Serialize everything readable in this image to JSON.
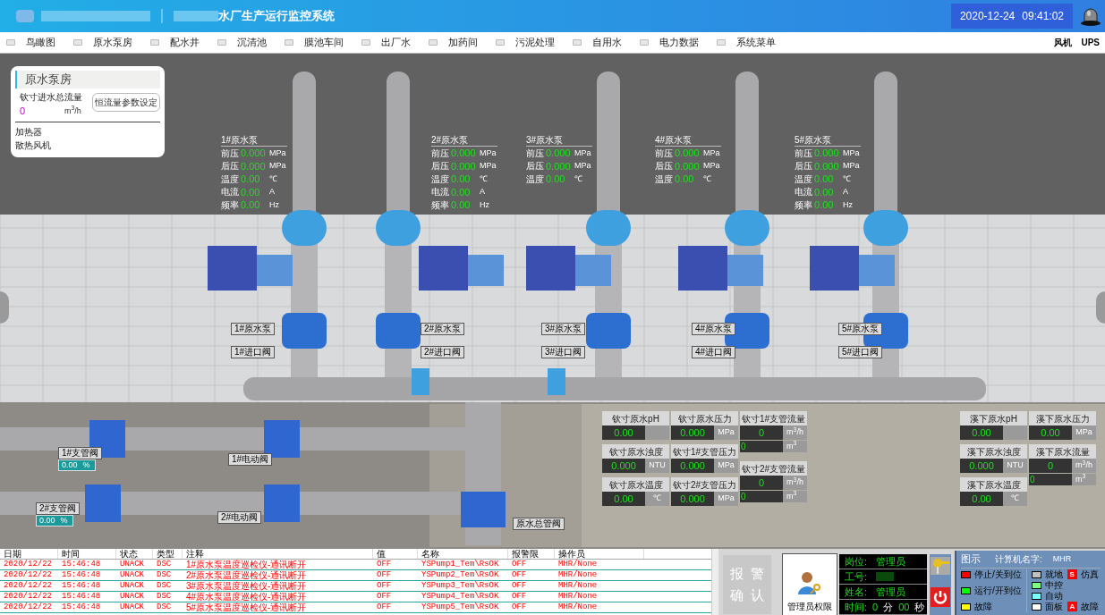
{
  "header": {
    "title": "水厂生产运行监控系统",
    "date": "2020-12-24",
    "time": "09:41:02"
  },
  "menu": {
    "items": [
      {
        "label": "鸟瞰图"
      },
      {
        "label": "原水泵房"
      },
      {
        "label": "配水井"
      },
      {
        "label": "沉清池"
      },
      {
        "label": "膜池车间"
      },
      {
        "label": "出厂水"
      },
      {
        "label": "加药间"
      },
      {
        "label": "污泥处理"
      },
      {
        "label": "自用水"
      },
      {
        "label": "电力数据"
      },
      {
        "label": "系统菜单"
      }
    ],
    "right": [
      "风机",
      "UPS"
    ]
  },
  "info_card": {
    "title": "原水泵房",
    "flow_label": "钦寸进水总流量",
    "flow_value": "0",
    "flow_unit": "m$^{3}$/h",
    "button": "恒流量参数设定",
    "items": [
      "加热器",
      "散热风机"
    ]
  },
  "pumps": [
    {
      "title": "1#原水泵",
      "params": [
        {
          "label": "前压",
          "value": "0.000",
          "unit": "MPa"
        },
        {
          "label": "后压",
          "value": "0.000",
          "unit": "MPa"
        },
        {
          "label": "温度",
          "value": "0.00",
          "unit": "℃"
        },
        {
          "label": "电流",
          "value": "0.00",
          "unit": "A"
        },
        {
          "label": "频率",
          "value": "0.00",
          "unit": "Hz"
        }
      ]
    },
    {
      "title": "2#原水泵",
      "params": [
        {
          "label": "前压",
          "value": "0.000",
          "unit": "MPa"
        },
        {
          "label": "后压",
          "value": "0.000",
          "unit": "MPa"
        },
        {
          "label": "温度",
          "value": "0.00",
          "unit": "℃"
        },
        {
          "label": "电流",
          "value": "0.00",
          "unit": "A"
        },
        {
          "label": "频率",
          "value": "0.00",
          "unit": "Hz"
        }
      ]
    },
    {
      "title": "3#原水泵",
      "params": [
        {
          "label": "前压",
          "value": "0.000",
          "unit": "MPa"
        },
        {
          "label": "后压",
          "value": "0.000",
          "unit": "MPa"
        },
        {
          "label": "温度",
          "value": "0.00",
          "unit": "℃"
        }
      ]
    },
    {
      "title": "4#原水泵",
      "params": [
        {
          "label": "前压",
          "value": "0.000",
          "unit": "MPa"
        },
        {
          "label": "后压",
          "value": "0.000",
          "unit": "MPa"
        },
        {
          "label": "温度",
          "value": "0.00",
          "unit": "℃"
        }
      ]
    },
    {
      "title": "5#原水泵",
      "params": [
        {
          "label": "前压",
          "value": "0.000",
          "unit": "MPa"
        },
        {
          "label": "后压",
          "value": "0.000",
          "unit": "MPa"
        },
        {
          "label": "温度",
          "value": "0.00",
          "unit": "℃"
        },
        {
          "label": "电流",
          "value": "0.00",
          "unit": "A"
        },
        {
          "label": "频率",
          "value": "0.00",
          "unit": "Hz"
        }
      ]
    }
  ],
  "equipment_tags": [
    {
      "pump": "1#原水泵",
      "valve": "1#进口阀"
    },
    {
      "pump": "2#原水泵",
      "valve": "2#进口阀"
    },
    {
      "pump": "3#原水泵",
      "valve": "3#进口阀"
    },
    {
      "pump": "4#原水泵",
      "valve": "4#进口阀"
    },
    {
      "pump": "5#原水泵",
      "valve": "5#进口阀"
    }
  ],
  "branch_valves": [
    {
      "label": "1#支管阀",
      "reading": "0.00",
      "unit": "%"
    },
    {
      "label": "2#支管阀",
      "reading": "0.00",
      "unit": "%"
    }
  ],
  "motor_valves": [
    "1#电动阀",
    "2#电动阀"
  ],
  "main_valve": "原水总管阀",
  "instrument_panels": [
    {
      "columns": [
        [
          {
            "kind": "single",
            "label": "钦寸原水pH",
            "value": "0.00"
          },
          {
            "kind": "single",
            "label": "钦寸原水浊度",
            "value": "0.000",
            "unit": "NTU"
          },
          {
            "kind": "single",
            "label": "钦寸原水温度",
            "value": "0.00",
            "unit": "℃"
          }
        ],
        [
          {
            "kind": "single",
            "label": "钦寸原水压力",
            "value": "0.000",
            "unit": "MPa"
          },
          {
            "kind": "single",
            "label": "钦寸1#支管压力",
            "value": "0.000",
            "unit": "MPa"
          },
          {
            "kind": "single",
            "label": "钦寸2#支管压力",
            "value": "0.000",
            "unit": "MPa"
          }
        ],
        [
          {
            "kind": "flow",
            "label": "钦寸1#支管流量",
            "value": "0",
            "unit": "m$^{3}$/h",
            "total": "0",
            "total_unit": "m$^{3}$"
          },
          {
            "kind": "flow",
            "label": "钦寸2#支管流量",
            "value": "0",
            "unit": "m$^{3}$/h",
            "total": "0",
            "total_unit": "m$^{3}$"
          }
        ]
      ]
    },
    {
      "columns": [
        [
          {
            "kind": "single",
            "label": "溪下原水pH",
            "value": "0.00"
          },
          {
            "kind": "single",
            "label": "溪下原水浊度",
            "value": "0.000",
            "unit": "NTU"
          },
          {
            "kind": "single",
            "label": "溪下原水温度",
            "value": "0.00",
            "unit": "℃"
          }
        ],
        [
          {
            "kind": "single",
            "label": "溪下原水压力",
            "value": "0.00",
            "unit": "MPa"
          },
          {
            "kind": "flow",
            "label": "溪下原水流量",
            "value": "0",
            "unit": "m$^{3}$/h",
            "total": "0",
            "total_unit": "m$^{3}$"
          }
        ]
      ]
    }
  ],
  "alarm_table": {
    "columns": [
      "日期",
      "时间",
      "状态",
      "类型",
      "注释",
      "值",
      "名称",
      "报警限",
      "操作员"
    ],
    "rows": [
      [
        "2020/12/22",
        "15:46:48",
        "UNACK",
        "DSC",
        "1#原水泵温度巡检仪-通讯断开",
        "OFF",
        "YSPump1_Tem\\RsOK",
        "OFF",
        "MHR/None"
      ],
      [
        "2020/12/22",
        "15:46:48",
        "UNACK",
        "DSC",
        "2#原水泵温度巡检仪-通讯断开",
        "OFF",
        "YSPump2_Tem\\RsOK",
        "OFF",
        "MHR/None"
      ],
      [
        "2020/12/22",
        "15:46:48",
        "UNACK",
        "DSC",
        "3#原水泵温度巡检仪-通讯断开",
        "OFF",
        "YSPump3_Tem\\RsOK",
        "OFF",
        "MHR/None"
      ],
      [
        "2020/12/22",
        "15:46:48",
        "UNACK",
        "DSC",
        "4#原水泵温度巡检仪-通讯断开",
        "OFF",
        "YSPump4_Tem\\RsOK",
        "OFF",
        "MHR/None"
      ],
      [
        "2020/12/22",
        "15:46:48",
        "UNACK",
        "DSC",
        "5#原水泵温度巡检仪-通讯断开",
        "OFF",
        "YSPump5_Tem\\RsOK",
        "OFF",
        "MHR/None"
      ]
    ]
  },
  "ack_button": "报警确认",
  "admin": {
    "label": "管理员权限"
  },
  "user_info": {
    "rows": [
      {
        "label": "岗位:",
        "value": "管理员"
      },
      {
        "label": "工号:"
      },
      {
        "label": "姓名:",
        "value": "管理员"
      }
    ],
    "time_label": "时间:",
    "minutes": "0",
    "minutes_unit": "分",
    "seconds": "00",
    "seconds_unit": "秒"
  },
  "legend": {
    "title": "图示",
    "computer_label": "计算机名字:",
    "computer": "MHR",
    "items": [
      {
        "kind": "swatch",
        "label": "停止/关到位",
        "color": "#ff0000"
      },
      {
        "kind": "swatch",
        "label": "运行/开到位",
        "color": "#00ff00"
      },
      {
        "kind": "swatch",
        "label": "故障",
        "color": "#ffff00"
      },
      {
        "kind": "swatch",
        "label": "就地",
        "color": "#c0c0c0"
      },
      {
        "kind": "swatch",
        "label": "中控",
        "color": "#80ff80"
      },
      {
        "kind": "swatch",
        "label": "自动",
        "color": "#80ffff"
      },
      {
        "kind": "swatch",
        "label": "面板",
        "color": "#ffffff"
      },
      {
        "kind": "badge",
        "letter": "S",
        "label": "仿真",
        "color": "#ff0000"
      },
      {
        "kind": "badge",
        "letter": "A",
        "label": "故障",
        "color": "#ff0000"
      }
    ]
  }
}
